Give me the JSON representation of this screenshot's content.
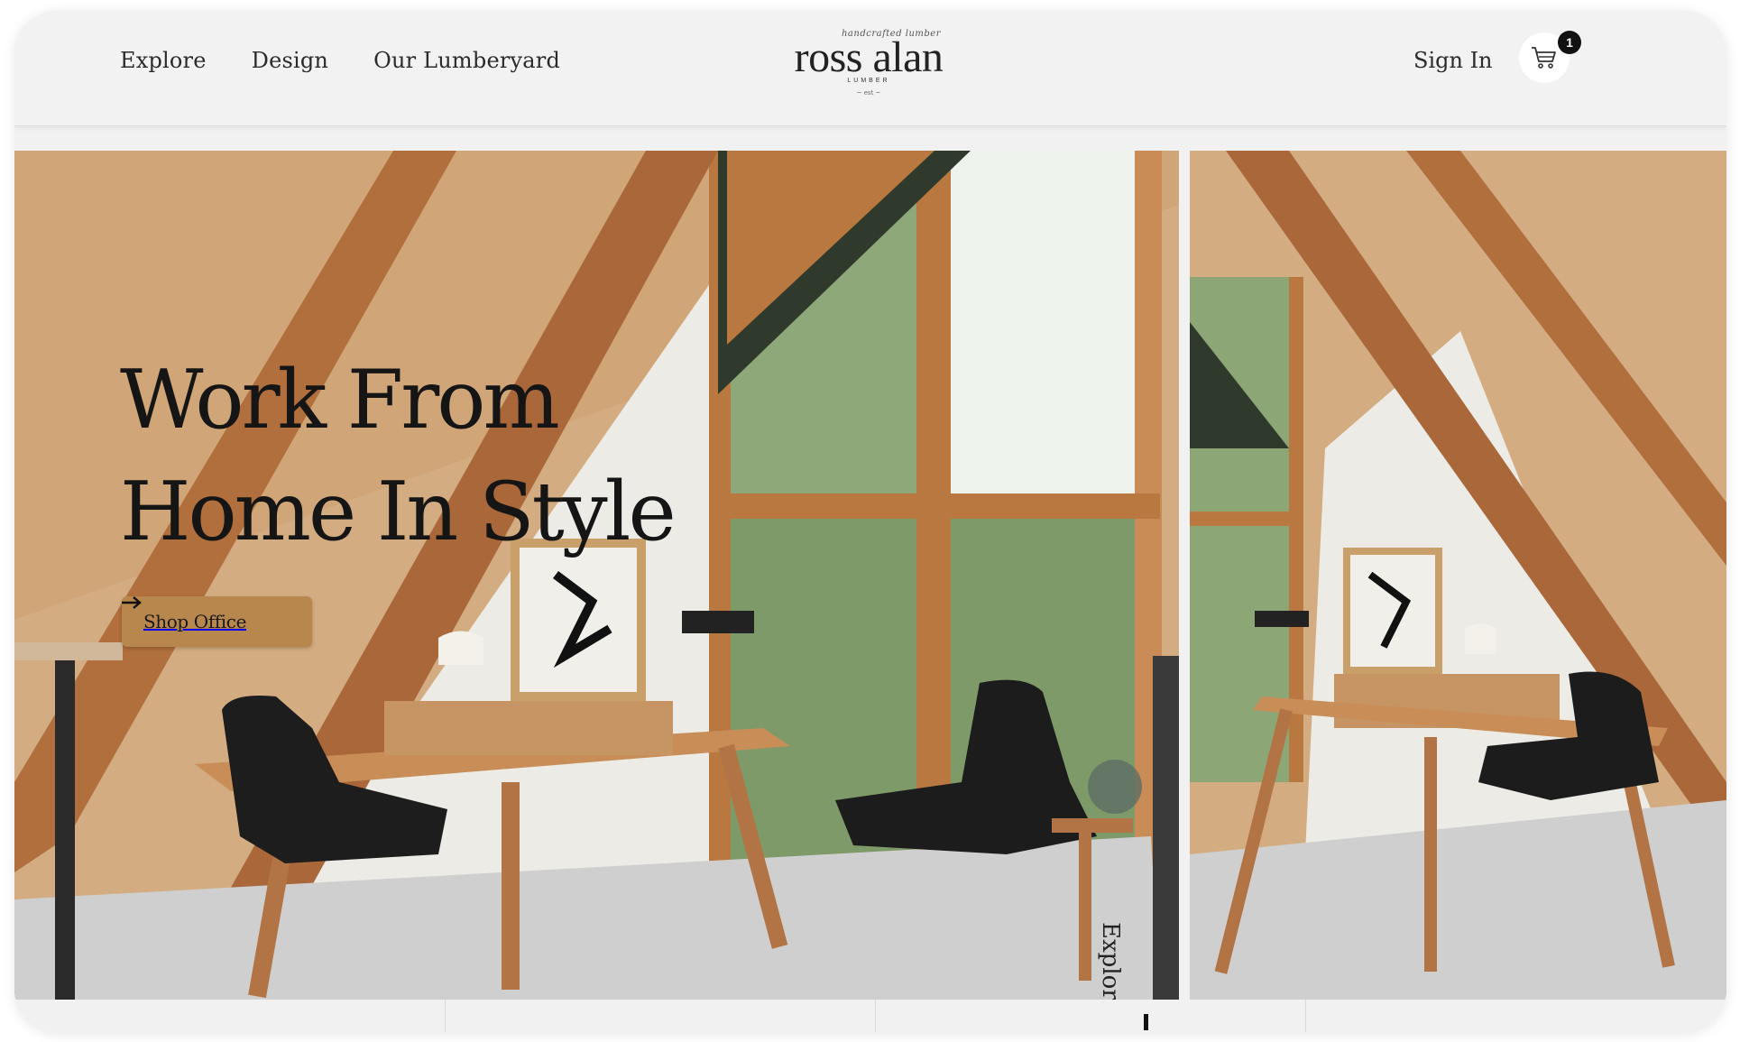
{
  "nav": {
    "items": [
      "Explore",
      "Design",
      "Our Lumberyard"
    ]
  },
  "logo": {
    "script": "handcrafted lumber",
    "name": "ross alan",
    "sub": "LUMBER",
    "est": "~ est ~"
  },
  "account": {
    "signin_label": "Sign In",
    "cart_count": "1",
    "cart_icon": "cart-icon"
  },
  "hero": {
    "headline_line1": "Work From",
    "headline_line2": "Home In Style",
    "cta_label": "Shop Office",
    "cta_icon": "arrow-right-icon",
    "vertical_label": "Explore"
  },
  "colors": {
    "accent": "#b8874d",
    "text": "#151515",
    "background": "#f1f1f1"
  }
}
